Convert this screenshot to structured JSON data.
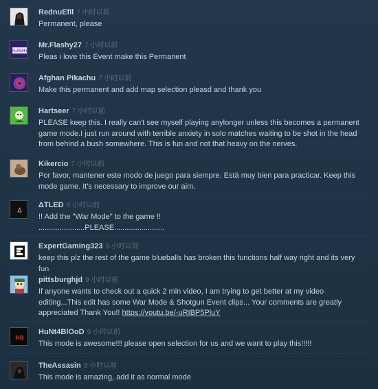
{
  "comments": [
    {
      "author": "RednuEfil",
      "time": "7 小时以前",
      "text": "Permanent, please",
      "avatar": "dark-portrait"
    },
    {
      "author": "Mr.Flashy27",
      "time": "7 小时以前",
      "text": "Pleas i love this Event make this Permanent",
      "avatar": "purple-logo"
    },
    {
      "author": "Afghan Pikachu",
      "time": "7 小时以前",
      "text": "Make this permanent and add map selection pleasd and thank you",
      "avatar": "purple-swirl"
    },
    {
      "author": "Hartseer",
      "time": "7 小时以前",
      "text": "PLEASE keep this. I really can't see myself playing anylonger unless this becomes a permanent game mode.I just run around with terrible anxiety in solo matches waiting to be shot in the head from behind a bush somewhere. This is fun and not that heavy on the nerves.",
      "avatar": "green-character"
    },
    {
      "author": "Kikercio",
      "time": "7 小时以前",
      "text": "Por favor, mantener este modo de juego para siempre. Está muy bien para practicar. Keep this mode game. It's necessary to improve our aim.",
      "avatar": "photo-dog"
    },
    {
      "author": "ΔTLED",
      "time": "8 小时以前",
      "text": "!! Add the \"War Mode\" to the game !!",
      "text2": "......................PLEASE........................",
      "avatar": "dark-emblem"
    },
    {
      "author": "ExpertGaming323",
      "time": "9 小时以前",
      "text": "keep this plz the rest of the game blueballs has broken this functions half way right and its very fun",
      "avatar": "bw-logo"
    },
    {
      "author": "pittsburghjd",
      "time": "9 小时以前",
      "text": "If anyone wants to check out a quick 2 min video, I am trying to get better at my video editing...This edit has some War Mode & Shotgun Event clips... Your comments are greatly appreciated Thank You!!",
      "link": "https://youtu.be/-uRIBP5PluY",
      "avatar": "cartoon-character"
    },
    {
      "author": "HuNt4BlOoD",
      "time": "9 小时以前",
      "text": "This mode is awesome!!! please open selection for us and we want to play this!!!!!",
      "avatar": "red-logo"
    },
    {
      "author": "TheAssasin",
      "time": "9 小时以前",
      "text": "This mode is amazing, add it as normal mode",
      "avatar": "hooded-figure"
    }
  ]
}
